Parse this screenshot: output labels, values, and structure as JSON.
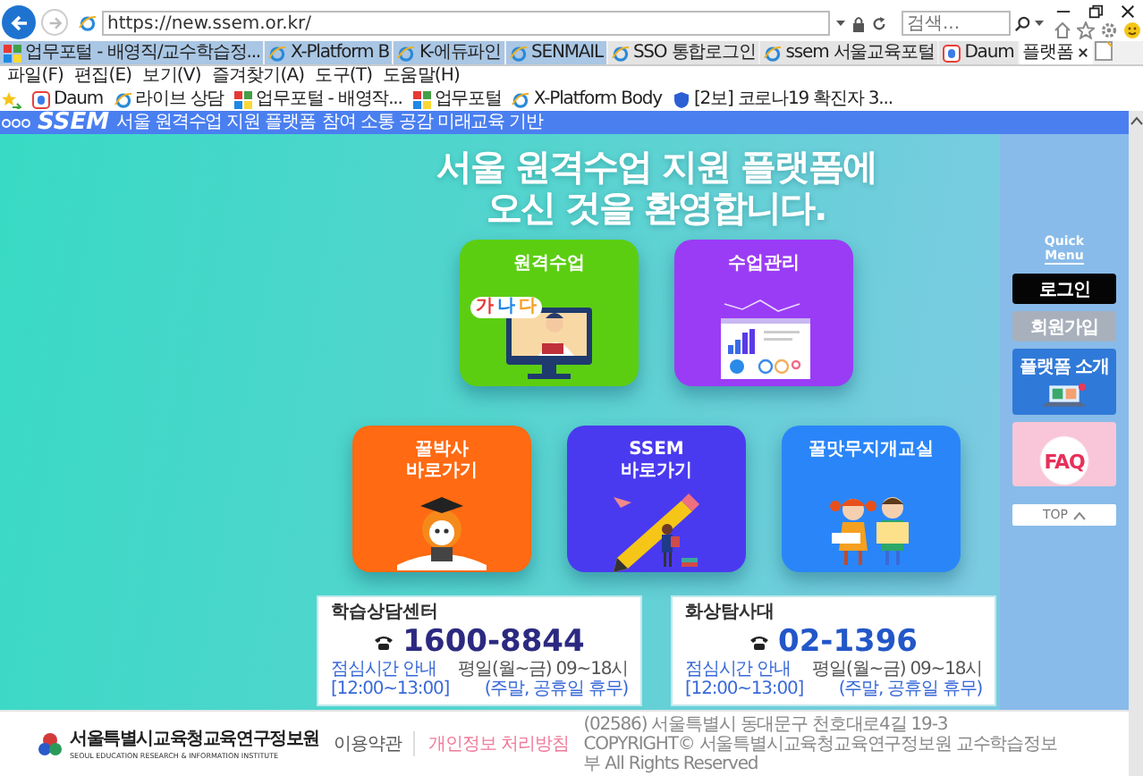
{
  "browser": {
    "address": "https://new.ssem.or.kr/",
    "search_placeholder": "검색...",
    "tabs": [
      {
        "label": "업무포털 - 배영직/교수학습정...",
        "kind": "grid",
        "grouped": true,
        "selected": false
      },
      {
        "label": "X-Platform B",
        "kind": "ie",
        "grouped": true,
        "selected": false
      },
      {
        "label": "K-에듀파인",
        "kind": "ie",
        "grouped": true,
        "selected": false
      },
      {
        "label": "SENMAIL",
        "kind": "ie",
        "grouped": true,
        "selected": false
      },
      {
        "label": "SSO 통합로그인",
        "kind": "ie",
        "grouped": false,
        "selected": false
      },
      {
        "label": "ssem 서울교육포털",
        "kind": "ie",
        "grouped": false,
        "selected": false
      },
      {
        "label": "Daum",
        "kind": "daum",
        "grouped": false,
        "selected": false
      },
      {
        "label": "플랫폼",
        "kind": "plain",
        "grouped": false,
        "selected": true
      }
    ],
    "menu": [
      "파일(F)",
      "편집(E)",
      "보기(V)",
      "즐겨찾기(A)",
      "도구(T)",
      "도움말(H)"
    ],
    "favorites": [
      {
        "label": "Daum",
        "kind": "daum"
      },
      {
        "label": "라이브 상담",
        "kind": "ie"
      },
      {
        "label": "업무포털 - 배영작...",
        "kind": "grid"
      },
      {
        "label": "업무포털",
        "kind": "grid"
      },
      {
        "label": "X-Platform Body",
        "kind": "ie"
      },
      {
        "label": "[2보] 코로나19 확진자 3...",
        "kind": "shield"
      }
    ]
  },
  "site_header": {
    "logo": "SSEM",
    "tagline_1": "서울 원격수업 지원 플랫폼",
    "tagline_2": "참여 소통 공감 미래교육 기반"
  },
  "hero": {
    "title_lines": [
      "서울 원격수업 지원 플랫폼에",
      "오신 것을 환영합니다."
    ]
  },
  "tile_rows": [
    [
      {
        "label_lines": [
          "원격수업"
        ],
        "color": "#5cce12",
        "kind": "teacher",
        "bubble": [
          "가",
          "나",
          "다"
        ]
      },
      {
        "label_lines": [
          "수업관리"
        ],
        "color": "#9a3cf5",
        "kind": "chart"
      }
    ],
    [
      {
        "label_lines": [
          "꿀박사",
          "바로가기"
        ],
        "color": "#ff6a12",
        "kind": "mascot"
      },
      {
        "label_lines": [
          "SSEM",
          "바로가기"
        ],
        "color": "#4a3aef",
        "kind": "pencil"
      },
      {
        "label_lines": [
          "꿀맛무지개교실"
        ],
        "color": "#2a86f8",
        "kind": "kids"
      }
    ]
  ],
  "contacts": [
    {
      "title": "학습상담센터",
      "phone": "1600-8844",
      "color": "#2c2a80",
      "hours": [
        "평일(월~금) 09~18시",
        "(주말, 공휴일 휴무)"
      ],
      "lunch": "점심시간 안내 [12:00~13:00]"
    },
    {
      "title": "화상탐사대",
      "phone": "02-1396",
      "color": "#2357c8",
      "hours": [
        "평일(월~금) 09~18시",
        "(주말, 공휴일 휴무)"
      ],
      "lunch": "점심시간 안내 [12:00~13:00]"
    }
  ],
  "quick_menu": {
    "title_lines": [
      "Quick",
      "Menu"
    ],
    "items": [
      {
        "label": "로그인",
        "kind": "dark"
      },
      {
        "label": "회원가입",
        "kind": "grey"
      },
      {
        "label": "플랫폼 소개",
        "kind": "intro"
      },
      {
        "label": "FAQ",
        "kind": "faq"
      }
    ],
    "top": "TOP"
  },
  "footer": {
    "org": "서울특별시교육청교육연구정보원",
    "org_en": "SEOUL EDUCATION RESEARCH & INFORMATION INSTITUTE",
    "links": [
      {
        "label": "이용약관",
        "kind": "normal"
      },
      {
        "label": "개인정보 처리방침",
        "kind": "highlight"
      }
    ],
    "address": "(02586) 서울특별시 동대문구 천호대로4길 19-3",
    "copyright": "COPYRIGHT© 서울특별시교육청교육연구정보원 교수학습정보부 All Rights Reserved"
  }
}
